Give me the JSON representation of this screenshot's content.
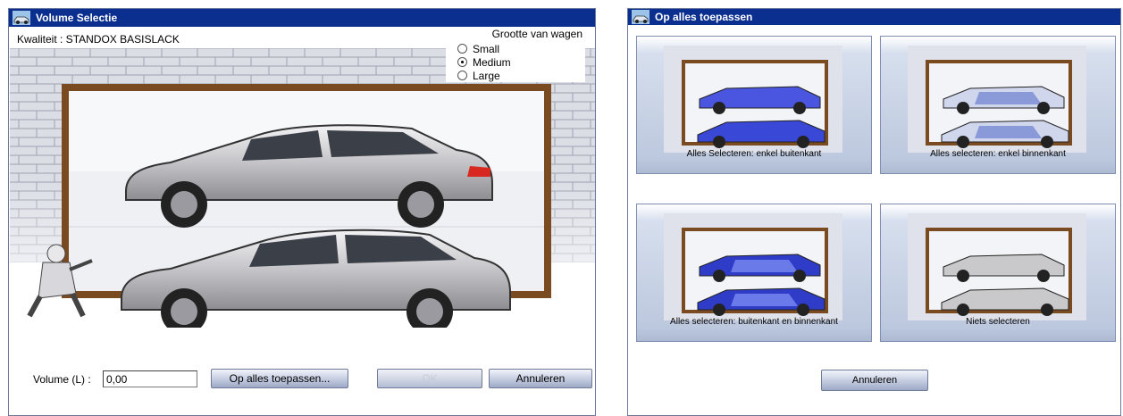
{
  "left_dialog": {
    "title": "Volume Selectie",
    "quality_label": "Kwaliteit : STANDOX BASISLACK",
    "car_size": {
      "heading": "Grootte van wagen",
      "options": [
        {
          "label": "Small",
          "selected": false
        },
        {
          "label": "Medium",
          "selected": true
        },
        {
          "label": "Large",
          "selected": false
        }
      ]
    },
    "volume_label": "Volume (L) :",
    "volume_value": "0,00",
    "buttons": {
      "apply_all": "Op alles toepassen...",
      "ok": "OK",
      "cancel": "Annuleren"
    }
  },
  "right_dialog": {
    "title": "Op alles toepassen",
    "options": [
      {
        "label": "Alles Selecteren: enkel buitenkant",
        "top_car": "blue",
        "bottom_car": "blue"
      },
      {
        "label": "Alles selecteren: enkel binnenkant",
        "top_car": "patterned",
        "bottom_car": "patterned"
      },
      {
        "label": "Alles selecteren: buitenkant en binnenkant",
        "top_car": "blue-patterned",
        "bottom_car": "blue-patterned"
      },
      {
        "label": "Niets selecteren",
        "top_car": "grey",
        "bottom_car": "grey"
      }
    ],
    "cancel_label": "Annuleren"
  },
  "colors": {
    "titlebar": "#0b2f8f",
    "car_grey": "#c9c9cc",
    "car_blue": "#3a48d8",
    "frame_brown": "#7a4a20",
    "brick_wall": "#d7d9e2"
  }
}
